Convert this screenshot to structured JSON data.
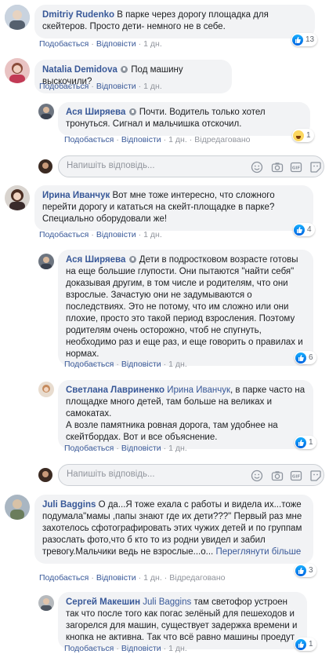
{
  "comments": [
    {
      "author": "Dmitriy Rudenko",
      "text": "В парке через дорогу площадка для скейтеров. Просто дети- немного не в себе.",
      "like": "Подобається",
      "reply": "Відповісти",
      "time": "1 дн.",
      "reactions": "13"
    },
    {
      "author": "Natalia Demidova",
      "text": "Под машину выскочили?",
      "like": "Подобається",
      "reply": "Відповісти",
      "time": "1 дн."
    },
    {
      "author": "Ирина Иванчук",
      "text": "Вот мне тоже интересно, что сложного перейти дорогу и кататься на скейт-площадке в парке? Специально оборудовали же!",
      "like": "Подобається",
      "reply": "Відповісти",
      "time": "1 дн.",
      "reactions": "4"
    },
    {
      "author": "Juli Baggins",
      "text": "О да...Я тоже ехала с работы и видела их...тоже подумала\"мамы ,папы знают где их дети???\" Первый раз мне захотелось сфотографировать этих чужих детей и по группам разослать фото,что б кто то из родни увидел и забил тревогу.Мальчики ведь не взрослые...о...",
      "see_more": "Переглянути більше",
      "like": "Подобається",
      "reply": "Відповісти",
      "time": "1 дн.",
      "edited": "Відредаговано",
      "reactions": "3"
    }
  ],
  "replies": [
    {
      "author": "Ася Ширяева",
      "text": "Почти. Водитель только хотел тронуться. Сигнал и мальчишка отскочил.",
      "like": "Подобається",
      "reply": "Відповісти",
      "time": "1 дн.",
      "edited": "Відредаговано",
      "reactions": "1"
    },
    {
      "author": "Ася Ширяева",
      "text": "Дети в подростковом возрасте готовы на еще большие глупости. Они пытаются \"найти себя\" доказывая другим, в том числе и родителям, что они взрослые. Зачастую они не задумываются о последствиях. Это не потому, что им сложно или они плохие, просто это такой период взросления. Поэтому родителям очень осторожно, чтоб не спугнуть, необходимо раз и еще раз, и еще говорить о правилах и нормах.",
      "like": "Подобається",
      "reply": "Відповісти",
      "time": "1 дн.",
      "reactions": "6"
    },
    {
      "author": "Светлана Лавриненко",
      "mention": "Ирина Иванчук",
      "text": ", в парке часто на площадке много детей, там больше на великах и самокатах.",
      "text2": "А возле памятника ровная дорога, там удобнее на скейтбордах. Вот и все объяснение.",
      "like": "Подобається",
      "reply": "Відповісти",
      "time": "1 дн.",
      "reactions": "1"
    },
    {
      "author": "Сергей Макешин",
      "mention": "Juli Baggins",
      "text": "там светофор устроен так что после того как погас зелёный для пешеходов и загорелся для машин, существует задержка времени и кнопка не активна. Так что всё равно машины проедут",
      "like": "Подобається",
      "reply": "Відповісти",
      "time": "1 дн.",
      "reactions": "1"
    }
  ],
  "reply_box": {
    "placeholder": "Напишіть відповідь..."
  },
  "colors": {
    "link": "#385898",
    "bubble": "#f2f3f5",
    "meta": "#90949c",
    "like": "#1877f2"
  }
}
